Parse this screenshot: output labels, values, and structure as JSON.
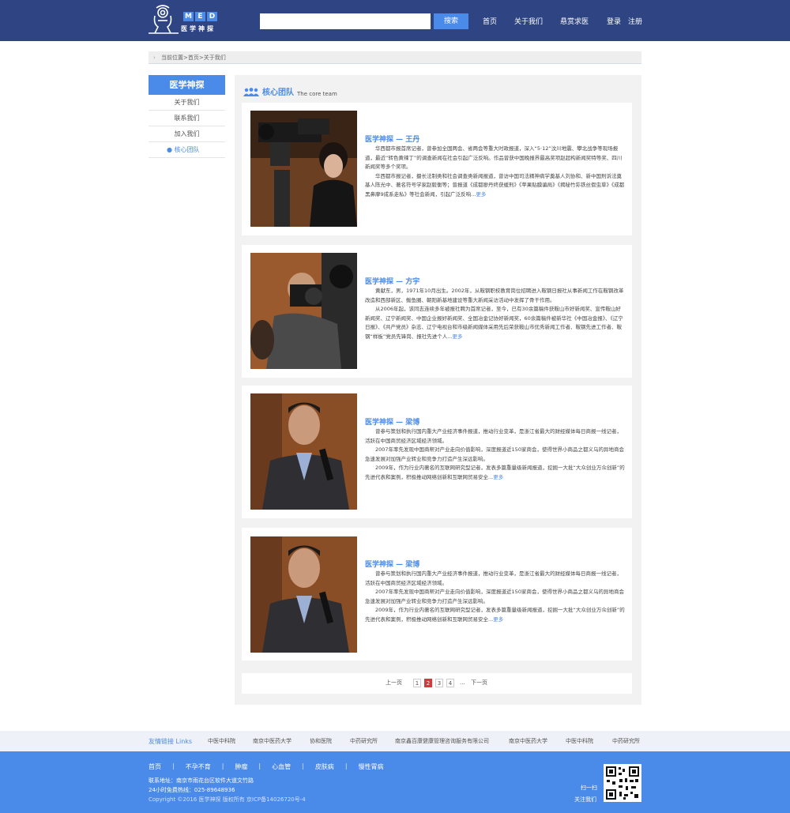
{
  "header": {
    "logo_letters": [
      "M",
      "E",
      "D"
    ],
    "logo_text": "医学神探",
    "search_placeholder": "",
    "search_button": "搜索",
    "nav": [
      "首页",
      "关于我们",
      "悬赏求医"
    ],
    "login": "登录",
    "register": "注册"
  },
  "breadcrumb": "当前位置>首页>关于我们",
  "sidebar": {
    "title": "医学神探",
    "items": [
      "关于我们",
      "联系我们",
      "加入我们",
      "核心团队"
    ],
    "active_index": 3
  },
  "section": {
    "title": "核心团队",
    "subtitle": "The core team"
  },
  "cards": [
    {
      "title": "医学神探 — 王丹",
      "paragraphs": [
        "华西都市报首席记者，曾参加全国两会、省两会等重大时政报道，深入“5·12”汶川地震、攀北战争等现场报道，最近“转色黄辣丁”的调查新闻在社会引起广泛反响。作品曾获中国晚报界最高奖项赵超构新闻奖特等奖、四川新闻奖等多个奖项。",
        "华西都市报记者，摄长法制类和社会调查类新闻报道，曾访中国司法精神病学奠基人刘协和、新中国刑诉法奠基人陈光中、著名符号学家赵毅衡等；曾报道《成都廖丹终获缓刑》《苹果贴膜骗局》《揭秘竹荪铁丝假虫草》《成都黑鼻摩9成系走私》等社会新闻，引起广泛反响..."
      ],
      "more": "更多"
    },
    {
      "title": "医学神探 — 方宇",
      "paragraphs": [
        "黄献东，男，1971年10月出生。2002年，从鞍钢职校教育岗位招聘进入鞍钢日报社从事新闻工作在鞍钢改革改造和西部新区、鲅鱼圈、朝阳新基地建设等重大新闻采访活动中发挥了骨干作用。",
        "从2006年起，该同志连续多年被报社聘为首席记者，至今，已有30余篇稿件获鞍山市好新闻奖、宣传鞍山好新闻奖、辽宁新闻奖、中国企业报好新闻奖、全国冶金记协好新闻奖，60余篇稿件被新华社《中国冶金报》、《辽宁日报》、《共产党员》杂志、辽宁电视台和市级新闻媒体采用先后荣获鞍山市优秀新闻工作者、鞍钢先进工作者、鞍钢“样板”党员先锋岗、报社先进个人..."
      ],
      "more": "更多"
    },
    {
      "title": "医学神探 — 梁博",
      "paragraphs": [
        "曾参与策划和执行国内重大产业经济事件报道，推动行业变革，是浙江省最大的财经媒体每日商报一线记者，活跃在中国商贸经济区域经济领域。",
        "2007年率先发现中国商帮对产业走向价值影响，深度报道近150家商会，使得世界小商品之都义乌的异地商会急速发展对加强产业转业和竞争力打造产生深远影响。",
        "2009年，作为行业内著名的互联网研究型记者，发表多篇重量级新闻报道，挖掘一大批“大众创业万众创新”的先进代表和案例，积极推动网络创新和互联网贸易安全..."
      ],
      "more": "更多"
    },
    {
      "title": "医学神探 — 梁博",
      "paragraphs": [
        "曾参与策划和执行国内重大产业经济事件报道，推动行业变革，是浙江省最大的财经媒体每日商报一线记者，活跃在中国商贸经济区域经济领域。",
        "2007年率先发现中国商帮对产业走向价值影响，深度报道近150家商会，使得世界小商品之都义乌的异地商会急速发展对加强产业转业和竞争力打造产生深远影响。",
        "2009年，作为行业内著名的互联网研究型记者，发表多篇重量级新闻报道，挖掘一大批“大众创业万众创新”的先进代表和案例，积极推动网络创新和互联网贸易安全..."
      ],
      "more": "更多"
    }
  ],
  "pagination": {
    "prev": "上一页",
    "pages": [
      "1",
      "2",
      "3",
      "4"
    ],
    "current": "2",
    "ellipsis": "...",
    "next": "下一页"
  },
  "links": {
    "title": "友情链接 Links",
    "items": [
      "中医中科院",
      "南京中医药大学",
      "协和医院",
      "中药研究所",
      "南京鑫百康健康管理咨询服务有限公司",
      "南京中医药大学",
      "中医中科院",
      "中药研究所"
    ]
  },
  "footer": {
    "nav": [
      "首页",
      "不孕不育",
      "肿瘤",
      "心血管",
      "皮肤病",
      "慢性胃病"
    ],
    "address": "联系地址：南京市雨花台区软件大道文竹路",
    "hotline": "24小时免费热线：025-89648936",
    "copyright": "Copyright ©2016 医学神探 版权所有 京ICP备14026720号-4",
    "qr_scan": "扫一扫",
    "qr_follow": "关注我们"
  },
  "colors": {
    "header_bg": "#2f4583",
    "accent": "#4a8ae8",
    "current_page": "#d9363e"
  }
}
